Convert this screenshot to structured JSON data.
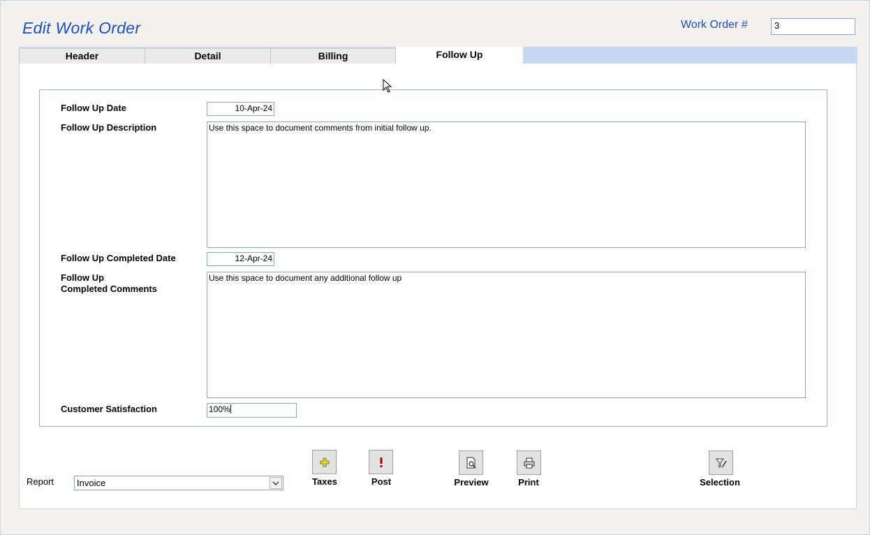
{
  "title": "Edit Work Order",
  "work_order": {
    "label": "Work Order #",
    "value": "3"
  },
  "tabs": [
    {
      "label": "Header",
      "active": false
    },
    {
      "label": "Detail",
      "active": false
    },
    {
      "label": "Billing",
      "active": false
    },
    {
      "label": "Follow Up",
      "active": true
    }
  ],
  "form": {
    "follow_up_date": {
      "label": "Follow Up Date",
      "value": "10-Apr-24"
    },
    "follow_up_description": {
      "label": "Follow Up Description",
      "value": "Use this space to document comments from initial follow up."
    },
    "follow_up_completed_date": {
      "label": "Follow Up Completed Date",
      "value": "12-Apr-24"
    },
    "follow_up_completed_comments": {
      "label_line1": "Follow Up",
      "label_line2": "Completed Comments",
      "value": "Use this space to document any additional follow up"
    },
    "customer_satisfaction": {
      "label": "Customer Satisfaction",
      "value": "100%"
    }
  },
  "report": {
    "label": "Report",
    "selected": "Invoice"
  },
  "buttons": {
    "taxes": {
      "label": "Taxes",
      "icon": "plus-icon"
    },
    "post": {
      "label": "Post",
      "icon": "exclamation-icon"
    },
    "preview": {
      "label": "Preview",
      "icon": "preview-icon"
    },
    "print": {
      "label": "Print",
      "icon": "printer-icon"
    },
    "selection": {
      "label": "Selection",
      "icon": "filter-icon"
    }
  },
  "colors": {
    "title": "#1d4fc4",
    "tab_strip": "#c5d9f3",
    "window_bg": "#f2f1ed"
  }
}
